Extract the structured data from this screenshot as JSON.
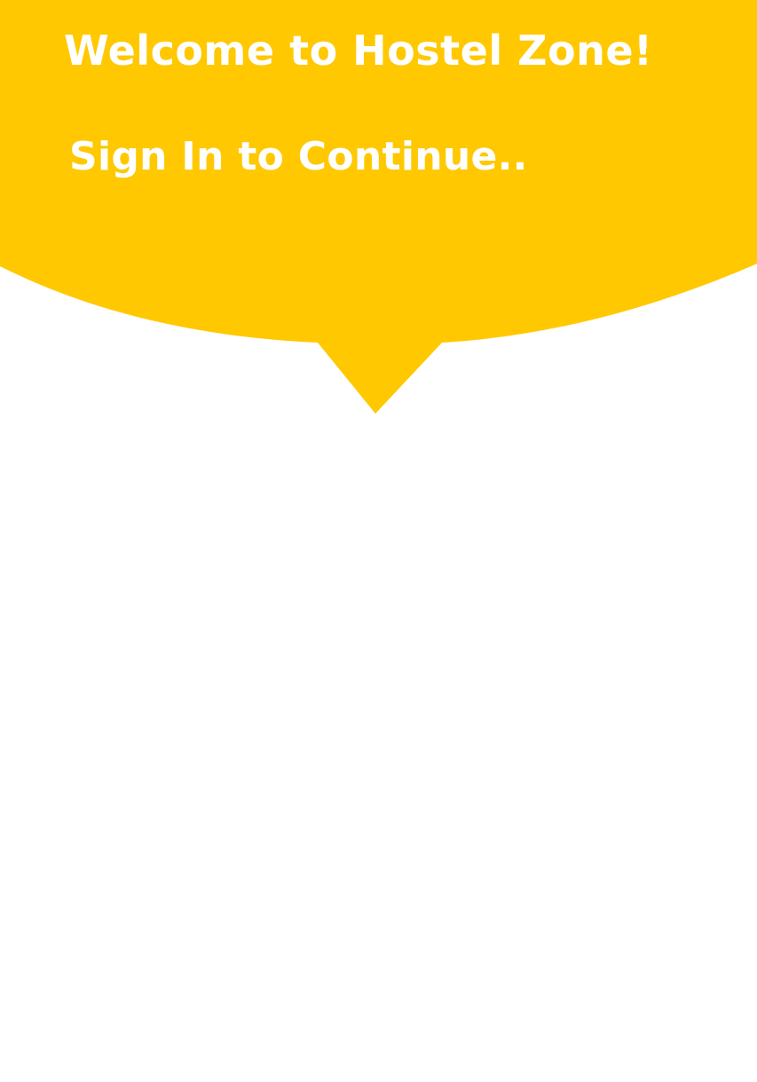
{
  "header": {
    "title": "Welcome to Hostel Zone!",
    "subtitle": "Sign In to Continue..",
    "background_color": "#FFC800",
    "text_color": "#FFFFFF"
  }
}
